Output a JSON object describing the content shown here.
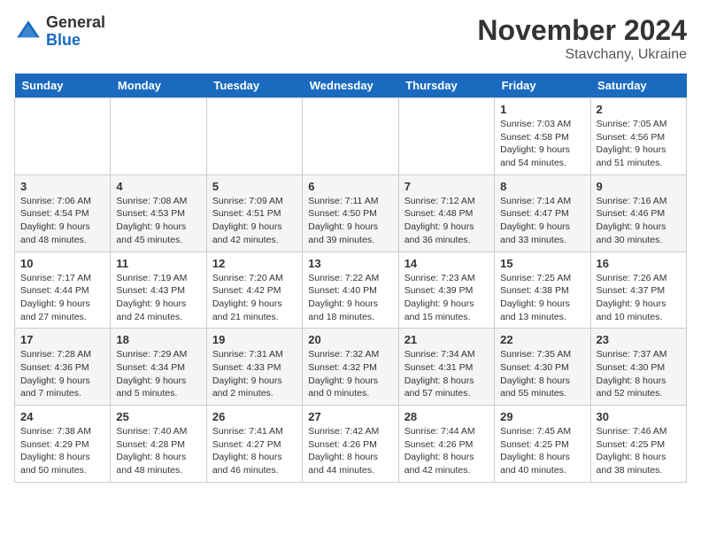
{
  "header": {
    "logo_general": "General",
    "logo_blue": "Blue",
    "month": "November 2024",
    "location": "Stavchany, Ukraine"
  },
  "days_of_week": [
    "Sunday",
    "Monday",
    "Tuesday",
    "Wednesday",
    "Thursday",
    "Friday",
    "Saturday"
  ],
  "weeks": [
    [
      {
        "day": "",
        "info": ""
      },
      {
        "day": "",
        "info": ""
      },
      {
        "day": "",
        "info": ""
      },
      {
        "day": "",
        "info": ""
      },
      {
        "day": "",
        "info": ""
      },
      {
        "day": "1",
        "info": "Sunrise: 7:03 AM\nSunset: 4:58 PM\nDaylight: 9 hours\nand 54 minutes."
      },
      {
        "day": "2",
        "info": "Sunrise: 7:05 AM\nSunset: 4:56 PM\nDaylight: 9 hours\nand 51 minutes."
      }
    ],
    [
      {
        "day": "3",
        "info": "Sunrise: 7:06 AM\nSunset: 4:54 PM\nDaylight: 9 hours\nand 48 minutes."
      },
      {
        "day": "4",
        "info": "Sunrise: 7:08 AM\nSunset: 4:53 PM\nDaylight: 9 hours\nand 45 minutes."
      },
      {
        "day": "5",
        "info": "Sunrise: 7:09 AM\nSunset: 4:51 PM\nDaylight: 9 hours\nand 42 minutes."
      },
      {
        "day": "6",
        "info": "Sunrise: 7:11 AM\nSunset: 4:50 PM\nDaylight: 9 hours\nand 39 minutes."
      },
      {
        "day": "7",
        "info": "Sunrise: 7:12 AM\nSunset: 4:48 PM\nDaylight: 9 hours\nand 36 minutes."
      },
      {
        "day": "8",
        "info": "Sunrise: 7:14 AM\nSunset: 4:47 PM\nDaylight: 9 hours\nand 33 minutes."
      },
      {
        "day": "9",
        "info": "Sunrise: 7:16 AM\nSunset: 4:46 PM\nDaylight: 9 hours\nand 30 minutes."
      }
    ],
    [
      {
        "day": "10",
        "info": "Sunrise: 7:17 AM\nSunset: 4:44 PM\nDaylight: 9 hours\nand 27 minutes."
      },
      {
        "day": "11",
        "info": "Sunrise: 7:19 AM\nSunset: 4:43 PM\nDaylight: 9 hours\nand 24 minutes."
      },
      {
        "day": "12",
        "info": "Sunrise: 7:20 AM\nSunset: 4:42 PM\nDaylight: 9 hours\nand 21 minutes."
      },
      {
        "day": "13",
        "info": "Sunrise: 7:22 AM\nSunset: 4:40 PM\nDaylight: 9 hours\nand 18 minutes."
      },
      {
        "day": "14",
        "info": "Sunrise: 7:23 AM\nSunset: 4:39 PM\nDaylight: 9 hours\nand 15 minutes."
      },
      {
        "day": "15",
        "info": "Sunrise: 7:25 AM\nSunset: 4:38 PM\nDaylight: 9 hours\nand 13 minutes."
      },
      {
        "day": "16",
        "info": "Sunrise: 7:26 AM\nSunset: 4:37 PM\nDaylight: 9 hours\nand 10 minutes."
      }
    ],
    [
      {
        "day": "17",
        "info": "Sunrise: 7:28 AM\nSunset: 4:36 PM\nDaylight: 9 hours\nand 7 minutes."
      },
      {
        "day": "18",
        "info": "Sunrise: 7:29 AM\nSunset: 4:34 PM\nDaylight: 9 hours\nand 5 minutes."
      },
      {
        "day": "19",
        "info": "Sunrise: 7:31 AM\nSunset: 4:33 PM\nDaylight: 9 hours\nand 2 minutes."
      },
      {
        "day": "20",
        "info": "Sunrise: 7:32 AM\nSunset: 4:32 PM\nDaylight: 9 hours\nand 0 minutes."
      },
      {
        "day": "21",
        "info": "Sunrise: 7:34 AM\nSunset: 4:31 PM\nDaylight: 8 hours\nand 57 minutes."
      },
      {
        "day": "22",
        "info": "Sunrise: 7:35 AM\nSunset: 4:30 PM\nDaylight: 8 hours\nand 55 minutes."
      },
      {
        "day": "23",
        "info": "Sunrise: 7:37 AM\nSunset: 4:30 PM\nDaylight: 8 hours\nand 52 minutes."
      }
    ],
    [
      {
        "day": "24",
        "info": "Sunrise: 7:38 AM\nSunset: 4:29 PM\nDaylight: 8 hours\nand 50 minutes."
      },
      {
        "day": "25",
        "info": "Sunrise: 7:40 AM\nSunset: 4:28 PM\nDaylight: 8 hours\nand 48 minutes."
      },
      {
        "day": "26",
        "info": "Sunrise: 7:41 AM\nSunset: 4:27 PM\nDaylight: 8 hours\nand 46 minutes."
      },
      {
        "day": "27",
        "info": "Sunrise: 7:42 AM\nSunset: 4:26 PM\nDaylight: 8 hours\nand 44 minutes."
      },
      {
        "day": "28",
        "info": "Sunrise: 7:44 AM\nSunset: 4:26 PM\nDaylight: 8 hours\nand 42 minutes."
      },
      {
        "day": "29",
        "info": "Sunrise: 7:45 AM\nSunset: 4:25 PM\nDaylight: 8 hours\nand 40 minutes."
      },
      {
        "day": "30",
        "info": "Sunrise: 7:46 AM\nSunset: 4:25 PM\nDaylight: 8 hours\nand 38 minutes."
      }
    ]
  ]
}
